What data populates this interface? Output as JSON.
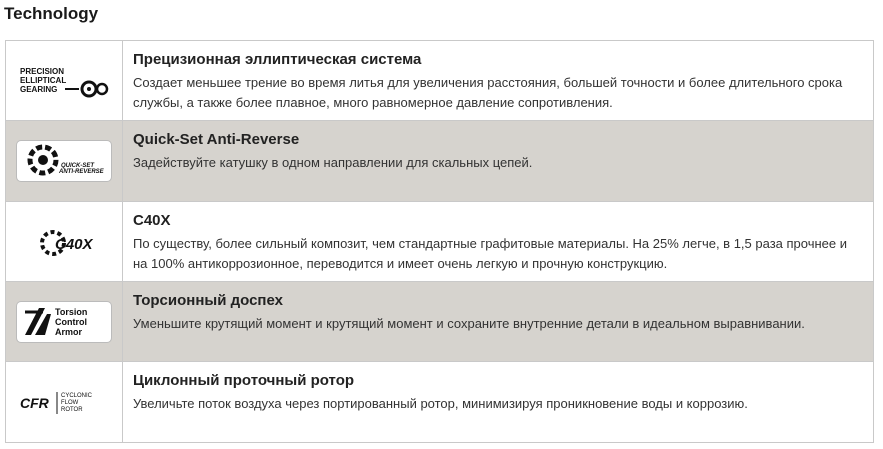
{
  "section": {
    "title": "Technology"
  },
  "rows": [
    {
      "logo": {
        "icon": "precision-elliptical-gearing-logo",
        "lines": [
          "PRECISION",
          "ELLIPTICAL",
          "GEARING"
        ]
      },
      "title": "Прецизионная эллиптическая система",
      "description": "Создает меньшее трение во время литья для увеличения расстояния, большей точности и более длительного срока службы, а также более плавное, много равномерное давление сопротивления."
    },
    {
      "logo": {
        "icon": "quick-set-anti-reverse-logo",
        "lines": [
          "QUICK-SET",
          "ANTI-REVERSE"
        ]
      },
      "title": "Quick-Set Anti-Reverse",
      "description": "Задействуйте катушку в одном направлении для скальных цепей."
    },
    {
      "logo": {
        "icon": "c40x-logo",
        "lines": [
          "C40X"
        ]
      },
      "title": "C40X",
      "description": "По существу, более сильный композит, чем стандартные графитовые материалы. На 25% легче, в 1,5 раза прочнее и на 100% антикоррозионное, переводится и имеет очень легкую и прочную конструкцию."
    },
    {
      "logo": {
        "icon": "torsion-control-armor-logo",
        "lines": [
          "Torsion",
          "Control",
          "Armor"
        ]
      },
      "title": "Торсионный доспех",
      "description": "Уменьшите крутящий момент и крутящий момент и сохраните внутренние детали в идеальном выравнивании."
    },
    {
      "logo": {
        "icon": "cyclonic-flow-rotor-logo",
        "lines": [
          "CFR",
          "CYCLONIC",
          "FLOW",
          "ROTOR"
        ]
      },
      "title": "Циклонный проточный ротор",
      "description": "Увеличьте поток воздуха через портированный ротор, минимизируя проникновение воды и коррозию."
    }
  ]
}
